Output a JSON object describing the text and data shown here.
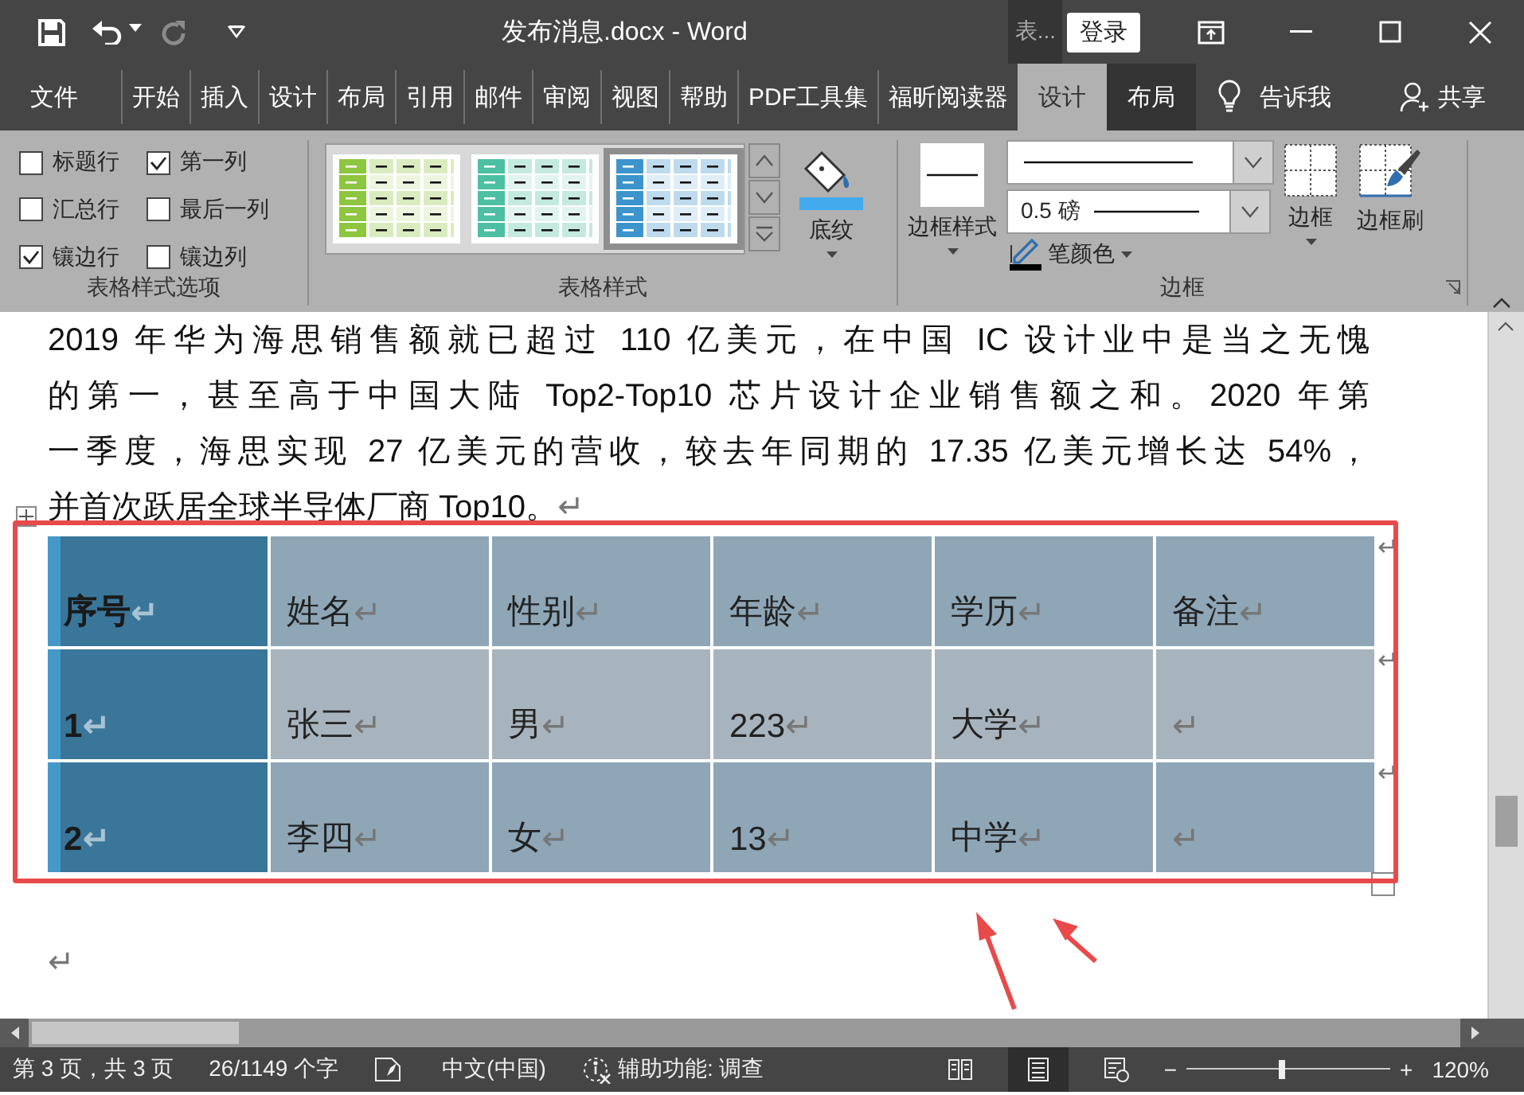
{
  "title_bar": {
    "quick_access": [
      {
        "kind": "save",
        "disabled": false
      },
      {
        "kind": "undo",
        "disabled": false
      },
      {
        "kind": "undo_menu",
        "disabled": false
      },
      {
        "kind": "redo",
        "disabled": true
      },
      {
        "kind": "customize",
        "disabled": false
      }
    ],
    "title": "发布消息.docx - Word",
    "context_label": "表...",
    "sign_in": "登录"
  },
  "tabs": [
    {
      "label": "文件",
      "selected": false,
      "contextual": false
    },
    {
      "label": "开始",
      "selected": false,
      "contextual": false
    },
    {
      "label": "插入",
      "selected": false,
      "contextual": false
    },
    {
      "label": "设计",
      "selected": false,
      "contextual": false
    },
    {
      "label": "布局",
      "selected": false,
      "contextual": false
    },
    {
      "label": "引用",
      "selected": false,
      "contextual": false
    },
    {
      "label": "邮件",
      "selected": false,
      "contextual": false
    },
    {
      "label": "审阅",
      "selected": false,
      "contextual": false
    },
    {
      "label": "视图",
      "selected": false,
      "contextual": false
    },
    {
      "label": "帮助",
      "selected": false,
      "contextual": false
    },
    {
      "label": "PDF工具集",
      "selected": false,
      "contextual": false
    },
    {
      "label": "福昕阅读器",
      "selected": false,
      "contextual": false
    },
    {
      "label": "设计",
      "selected": true,
      "contextual": true
    },
    {
      "label": "布局",
      "selected": false,
      "contextual": true
    }
  ],
  "tell_me": "告诉我",
  "share": "共享",
  "style_options": {
    "title": "表格样式选项",
    "options": [
      {
        "label": "标题行",
        "checked": false
      },
      {
        "label": "第一列",
        "checked": true
      },
      {
        "label": "汇总行",
        "checked": false
      },
      {
        "label": "最后一列",
        "checked": false
      },
      {
        "label": "镶边行",
        "checked": true
      },
      {
        "label": "镶边列",
        "checked": false
      }
    ]
  },
  "table_styles": {
    "title": "表格样式",
    "styles": [
      {
        "color": "#8dc63f",
        "selected": false
      },
      {
        "color": "#4dbfa3",
        "selected": false
      },
      {
        "color": "#3d94cc",
        "selected": true
      }
    ],
    "shading": "底纹"
  },
  "borders": {
    "title": "边框",
    "border_styles": "边框样式",
    "weight": "0.5 磅",
    "pen_color": "笔颜色",
    "borders": "边框",
    "border_painter": "边框刷"
  },
  "document": {
    "paragraph": [
      "2019 年华为海思销售额就已超过 110 亿美元，在中国 IC 设计业中是当之无愧",
      "的第一，甚至高于中国大陆 Top2-Top10 芯片设计企业销售额之和。2020 年第",
      "一季度，海思实现 27 亿美元的营收，较去年同期的 17.35 亿美元增长达 54%，",
      "并首次跃居全球半导体厂商 Top10。"
    ],
    "paragraph_mark": "↵",
    "table": {
      "rows": [
        {
          "cells": [
            {
              "text": "序号",
              "mark": "↵"
            },
            {
              "text": "姓名",
              "mark": "↵"
            },
            {
              "text": "性别",
              "mark": "↵"
            },
            {
              "text": "年龄",
              "mark": "↵"
            },
            {
              "text": "学历",
              "mark": "↵"
            },
            {
              "text": "备注",
              "mark": "↵"
            }
          ],
          "end_mark": "↵"
        },
        {
          "cells": [
            {
              "text": "1",
              "mark": "↵"
            },
            {
              "text": "张三",
              "mark": "↵"
            },
            {
              "text": "男",
              "mark": "↵"
            },
            {
              "text": "223",
              "mark": "↵"
            },
            {
              "text": "大学",
              "mark": "↵"
            },
            {
              "text": "",
              "mark": "↵"
            }
          ],
          "end_mark": "↵"
        },
        {
          "cells": [
            {
              "text": "2",
              "mark": "↵"
            },
            {
              "text": "李四",
              "mark": "↵"
            },
            {
              "text": "女",
              "mark": "↵"
            },
            {
              "text": "13",
              "mark": "↵"
            },
            {
              "text": "中学",
              "mark": "↵"
            },
            {
              "text": "",
              "mark": "↵"
            }
          ],
          "end_mark": "↵"
        }
      ]
    },
    "empty_paragraph_mark": "↵"
  },
  "status_bar": {
    "page": "第 3 页，共 3 页",
    "words": "26/1149 个字",
    "language": "中文(中国)",
    "accessibility": "辅助功能: 调查",
    "views": [
      {
        "kind": "read",
        "selected": false
      },
      {
        "kind": "print",
        "selected": true
      },
      {
        "kind": "web",
        "selected": false
      }
    ],
    "zoom_out": "−",
    "zoom_in": "+",
    "zoom": {
      "level": 0.47
    },
    "zoom_text": "120%"
  }
}
